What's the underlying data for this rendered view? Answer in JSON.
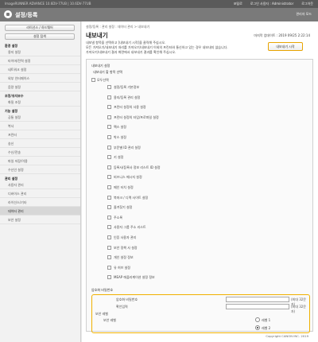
{
  "topbar": {
    "device": "ImageRUNNER ADVANCE  10.6DV-77UB  |  10.6DV-77UB",
    "portal": "포털로",
    "login_user_label": "로그인 사용자 : Administrator",
    "logout": "로그아웃"
  },
  "header": {
    "title": "설정/등록",
    "mode": "관리자 모드"
  },
  "sidebar": {
    "buttons": [
      "라이선스 / 하드웨어",
      "설정 탐색"
    ],
    "groups": [
      {
        "title": "환경 설정",
        "items": [
          "용지 설정",
          "타이머/전력 설정",
          "네트워크 설정",
          "외부 인터페이스",
          "음량 설정"
        ]
      },
      {
        "title": "조정/유지보수",
        "items": [
          "화질 조정"
        ]
      },
      {
        "title": "기능 설정",
        "items": [
          "공통 설정",
          "복사",
          "프린터",
          "송신",
          "수신/전송",
          "파일 저장/이용",
          "수신인 설정"
        ]
      },
      {
        "title": "관리 설정",
        "items": [
          "사용자 관리",
          "디바이스 관리",
          "라이선스/기타",
          "데이터 관리",
          "보안 설정"
        ]
      }
    ],
    "selected": "데이터 관리"
  },
  "content": {
    "breadcrumb": "설정/등록 : 관리 설정 : 데이터 관리 > 내보내기",
    "title": "내보내기",
    "last_update": "마지막 업데이트 : 2019 09/25 2:22:14",
    "description": [
      "내보낼 항목을 선택하고 [내보내기 시작]을 클릭해 주십시오.",
      "모든 가져오기/내보내기 처리를 가져오기/내보내기 이외의 프린터와 통신하고 있는 경우 내보내지 않습니다.",
      "가져오기/내보내기 결과 화면에서 내보내기 결과를 확인해 주십시오."
    ],
    "start_button": "내보내기 시작",
    "export_settings_label": "내보내기 설정",
    "items_section_label": "내보내기 할 항목 선택",
    "select_all": "모두선택",
    "items": [
      "설정/등록 기본정보",
      "용지/등록 관리 설정",
      "프린터 설정의 사용 설정",
      "프린터 설정의 타입/프로파일 설정",
      "팩스 설정",
      "박스 설정",
      "부문별 ID 관리 설정",
      "키 설정",
      "등록사/등록사 정보 리스트 ID 설정",
      "비즈니스 메시지 설정",
      "메인 터치 설정",
      "북마크 / 디렉 사이트 설정",
      "즐겨찾기 설정",
      "주소록",
      "사용자 그룹 주소 리스트",
      "인증 사용자 관리",
      "보안 정책 사 설정",
      "개인 설정 정보",
      "유 허브 설정",
      "MEAP 애플리케이션 설정 정보"
    ],
    "encryption": {
      "section_label": "암호화 비밀번호",
      "password_label": "암호화 비밀번호",
      "password_note": "(최대 32문자)",
      "confirm_label": "확인입력",
      "confirm_note": "(최대 32문자)",
      "security_section_label": "보안 레벨",
      "level_label": "보안 레벨",
      "levels": [
        "레벨 1",
        "레벨 2"
      ],
      "selected_level": "레벨 2"
    },
    "copyright": "Copyright CANON INC. 2019"
  }
}
